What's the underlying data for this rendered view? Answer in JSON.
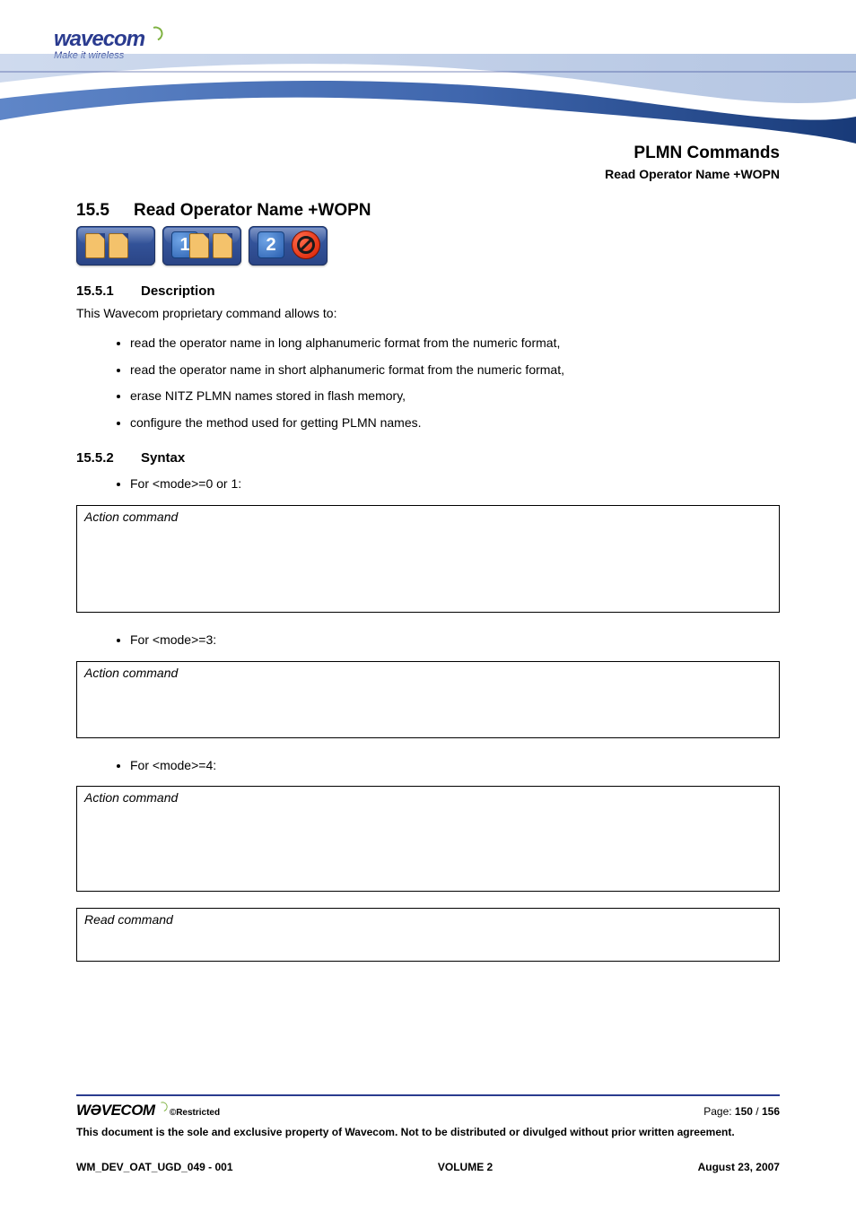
{
  "logo": {
    "brand": "wavecom",
    "tagline": "Make it wireless"
  },
  "header": {
    "category": "PLMN Commands",
    "subtitle": "Read Operator Name +WOPN"
  },
  "section": {
    "number": "15.5",
    "title": "Read Operator Name +WOPN"
  },
  "icons": {
    "badge1": "dual-sim",
    "badge2_num": "1",
    "badge3_num": "2",
    "badge3_symbol": "prohibited"
  },
  "sub1": {
    "number": "15.5.1",
    "title": "Description",
    "intro": "This Wavecom proprietary command allows to:",
    "bullets": [
      "read the operator name in long alphanumeric format from the numeric format,",
      "read the operator name in short alphanumeric format from the numeric format,",
      "erase NITZ PLMN names stored in flash memory,",
      "configure the method used for getting PLMN names."
    ]
  },
  "sub2": {
    "number": "15.5.2",
    "title": "Syntax",
    "items": [
      {
        "cond": "For <mode>=0 or 1:",
        "box_label": "Action command"
      },
      {
        "cond": "For <mode>=3:",
        "box_label": "Action command"
      },
      {
        "cond": "For <mode>=4:",
        "box_label": "Action command"
      }
    ],
    "read_box_label": "Read command"
  },
  "footer": {
    "brand": "WƏVECOM",
    "restricted": "©Restricted",
    "page_label": "Page: ",
    "page_current": "150",
    "page_sep": " / ",
    "page_total": "156",
    "note": "This document is the sole and exclusive property of Wavecom. Not to be distributed or divulged without prior written agreement.",
    "docref": "WM_DEV_OAT_UGD_049 - 001",
    "volume": "VOLUME 2",
    "date": "August 23, 2007"
  }
}
